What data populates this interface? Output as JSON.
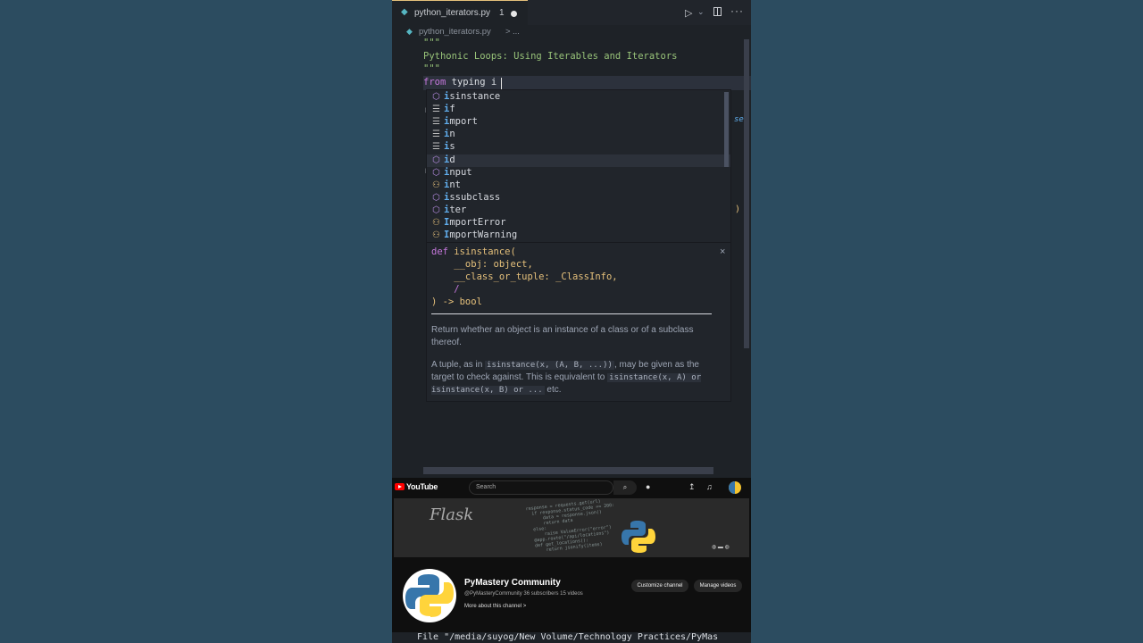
{
  "tab": {
    "filename": "python_iterators.py",
    "badge": "1"
  },
  "breadcrumb": {
    "file": "python_iterators.py",
    "separator": ">",
    "more": "..."
  },
  "code": {
    "docstring_open": "\"\"\"",
    "docstring_text": "Pythonic Loops: Using Iterables and Iterators",
    "docstring_close": "\"\"\"",
    "import_kw": "from",
    "import_module": " typing i"
  },
  "suggestions": [
    {
      "label_match": "i",
      "label_rest": "sinstance",
      "icon": "method-icon"
    },
    {
      "label_match": "i",
      "label_rest": "f",
      "icon": "keyword-icon"
    },
    {
      "label_match": "i",
      "label_rest": "mport",
      "icon": "keyword-icon"
    },
    {
      "label_match": "i",
      "label_rest": "n",
      "icon": "keyword-icon"
    },
    {
      "label_match": "i",
      "label_rest": "s",
      "icon": "keyword-icon"
    },
    {
      "label_match": "i",
      "label_rest": "d",
      "icon": "method-icon"
    },
    {
      "label_match": "i",
      "label_rest": "nput",
      "icon": "method-icon"
    },
    {
      "label_match": "i",
      "label_rest": "nt",
      "icon": "class-icon"
    },
    {
      "label_match": "i",
      "label_rest": "ssubclass",
      "icon": "method-icon"
    },
    {
      "label_match": "i",
      "label_rest": "ter",
      "icon": "method-icon"
    },
    {
      "label_match": "I",
      "label_rest": "mportError",
      "icon": "class-icon"
    },
    {
      "label_match": "I",
      "label_rest": "mportWarning",
      "icon": "class-icon"
    }
  ],
  "details": {
    "sig_def": "def",
    "sig_name": " isinstance(",
    "sig_param1": "    __obj: object,",
    "sig_param2": "    __class_or_tuple: _ClassInfo,",
    "sig_slash": "    /",
    "sig_return": ") -> bool",
    "close": "×",
    "desc1": "Return whether an object is an instance of a class or of a subclass thereof.",
    "desc2_a": "A tuple, as in ",
    "desc2_code1": "isinstance(x, (A, B, ...))",
    "desc2_b": ", may be given as the target to check against. This is equivalent to ",
    "desc2_code2": "isinstance(x, A) or isinstance(x, B) or ...",
    "desc2_c": " etc."
  },
  "youtube": {
    "logo_text": "YouTube",
    "search_placeholder": "Search",
    "banner_title": "Flask",
    "channel_name": "PyMastery Community",
    "channel_meta": "@PyMasteryCommunity  36 subscribers  15 videos",
    "more_about": "More about this channel  >",
    "customize_btn": "Customize channel",
    "manage_btn": "Manage videos"
  },
  "terminal": {
    "line": "File \"/media/suyog/New Volume/Technology Practices/PyMas"
  },
  "colors": {
    "accent": "#e5c07b",
    "string": "#98c379",
    "keyword": "#c678dd",
    "match": "#61afef"
  }
}
